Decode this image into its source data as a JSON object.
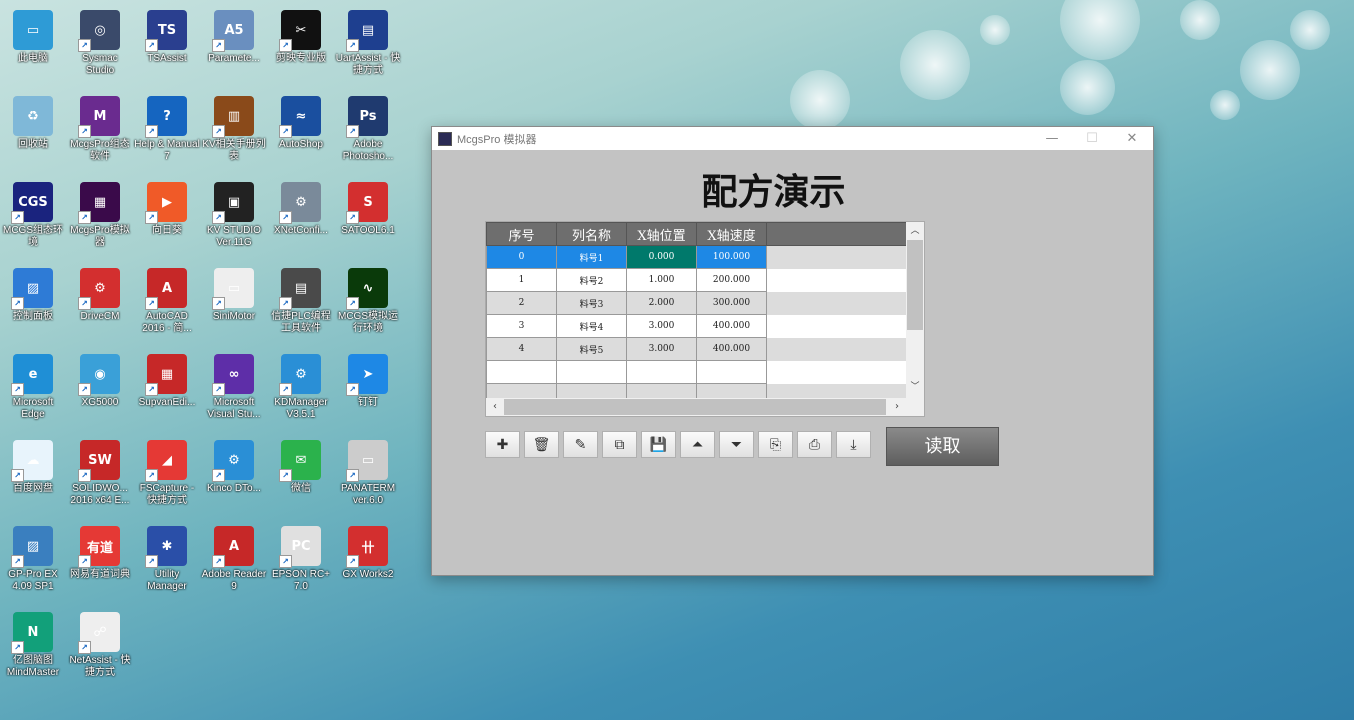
{
  "desktop": {
    "icons": [
      {
        "label": "此电脑",
        "color": "#2e9bd6",
        "glyph": "▭"
      },
      {
        "label": "Sysmac Studio",
        "color": "#3a4a6a",
        "glyph": "◎"
      },
      {
        "label": "TSAssist",
        "color": "#2a3f8f",
        "glyph": "TS"
      },
      {
        "label": "Paramete...",
        "color": "#6a8fbf",
        "glyph": "A5"
      },
      {
        "label": "剪映专业版",
        "color": "#111111",
        "glyph": "✂"
      },
      {
        "label": "UartAssist - 快捷方式",
        "color": "#1e3f8f",
        "glyph": "▤"
      },
      {
        "label": "回收站",
        "color": "#7fb8d8",
        "glyph": "♻"
      },
      {
        "label": "McgsPro组态软件",
        "color": "#6a2b8f",
        "glyph": "M"
      },
      {
        "label": "Help & Manual 7",
        "color": "#1565c0",
        "glyph": "?"
      },
      {
        "label": "KV相关手册列表",
        "color": "#8a4a1a",
        "glyph": "▥"
      },
      {
        "label": "AutoShop",
        "color": "#1a4f9f",
        "glyph": "≈"
      },
      {
        "label": "Adobe Photosho...",
        "color": "#1f3a6f",
        "glyph": "Ps"
      },
      {
        "label": "MCGS组态环境",
        "color": "#1a237e",
        "glyph": "CGS"
      },
      {
        "label": "McgsPro模拟器",
        "color": "#3a0a4a",
        "glyph": "▦"
      },
      {
        "label": "向日葵",
        "color": "#f05a28",
        "glyph": "▶"
      },
      {
        "label": "KV STUDIO Ver.11G",
        "color": "#222222",
        "glyph": "▣"
      },
      {
        "label": "XNetConfi...",
        "color": "#7a8a9a",
        "glyph": "⚙"
      },
      {
        "label": "SATOOL6.1",
        "color": "#d32f2f",
        "glyph": "S"
      },
      {
        "label": "控制面板",
        "color": "#2e7bd6",
        "glyph": "▨"
      },
      {
        "label": "DriveCM",
        "color": "#d32f2f",
        "glyph": "⚙"
      },
      {
        "label": "AutoCAD 2016 - 简...",
        "color": "#c62828",
        "glyph": "A"
      },
      {
        "label": "SiniMotor",
        "color": "#eeeeee",
        "glyph": "▭"
      },
      {
        "label": "信捷PLC编程工具软件",
        "color": "#4a4a4a",
        "glyph": "▤"
      },
      {
        "label": "MCGS模拟运行环境",
        "color": "#0a3a0a",
        "glyph": "∿"
      },
      {
        "label": "Microsoft Edge",
        "color": "#1f8fd6",
        "glyph": "e"
      },
      {
        "label": "XG5000",
        "color": "#3aa0d8",
        "glyph": "◉"
      },
      {
        "label": "SupvanEdi...",
        "color": "#c62828",
        "glyph": "▦"
      },
      {
        "label": "Microsoft Visual Stu...",
        "color": "#5e2ea8",
        "glyph": "∞"
      },
      {
        "label": "KDManager V3.5.1",
        "color": "#2a8fd6",
        "glyph": "⚙"
      },
      {
        "label": "钉钉",
        "color": "#1e88e5",
        "glyph": "➤"
      },
      {
        "label": "百度网盘",
        "color": "#e8f4fc",
        "glyph": "☁"
      },
      {
        "label": "SOLIDWO... 2016 x64 E...",
        "color": "#c62828",
        "glyph": "SW"
      },
      {
        "label": "FSCapture - 快捷方式",
        "color": "#e53935",
        "glyph": "◢"
      },
      {
        "label": "Kinco DTo...",
        "color": "#2a8fd6",
        "glyph": "⚙"
      },
      {
        "label": "微信",
        "color": "#2bb24c",
        "glyph": "✉"
      },
      {
        "label": "PANATERM ver.6.0",
        "color": "#cccccc",
        "glyph": "▭"
      },
      {
        "label": "GP-Pro EX 4.09 SP1",
        "color": "#3a7fbf",
        "glyph": "▨"
      },
      {
        "label": "网易有道词典",
        "color": "#e53935",
        "glyph": "有道"
      },
      {
        "label": "Utility Manager",
        "color": "#2a4fa8",
        "glyph": "✱"
      },
      {
        "label": "Adobe Reader 9",
        "color": "#c62828",
        "glyph": "A"
      },
      {
        "label": "EPSON RC+ 7.0",
        "color": "#e0e0e0",
        "glyph": "PC"
      },
      {
        "label": "GX Works2",
        "color": "#d32f2f",
        "glyph": "卄"
      },
      {
        "label": "亿图脑图MindMaster",
        "color": "#12a07a",
        "glyph": "N"
      },
      {
        "label": "NetAssist - 快捷方式",
        "color": "#eeeeee",
        "glyph": "☍"
      }
    ]
  },
  "window": {
    "title": "McgsPro 模拟器",
    "min_glyph": "—",
    "max_glyph": "☐",
    "close_glyph": "✕",
    "heading": "配方演示",
    "table": {
      "columns": [
        "序号",
        "列名称",
        "X轴位置",
        "X轴速度"
      ],
      "rows": [
        [
          "0",
          "料号1",
          "0.000",
          "100.000"
        ],
        [
          "1",
          "料号2",
          "1.000",
          "200.000"
        ],
        [
          "2",
          "料号3",
          "2.000",
          "300.000"
        ],
        [
          "3",
          "料号4",
          "3.000",
          "400.000"
        ],
        [
          "4",
          "料号5",
          "3.000",
          "400.000"
        ]
      ],
      "selected_row": 0
    },
    "scroll": {
      "up": "︿",
      "down": "﹀",
      "left": "‹",
      "right": "›"
    },
    "toolbar": [
      {
        "name": "add-row-icon",
        "glyph": "✚"
      },
      {
        "name": "delete-row-icon",
        "glyph": "🗑"
      },
      {
        "name": "edit-icon",
        "glyph": "✎"
      },
      {
        "name": "copy-icon",
        "glyph": "⧉"
      },
      {
        "name": "save-icon",
        "glyph": "💾"
      },
      {
        "name": "move-top-icon",
        "glyph": "⏶"
      },
      {
        "name": "move-bottom-icon",
        "glyph": "⏷"
      },
      {
        "name": "import-icon",
        "glyph": "⎘"
      },
      {
        "name": "export-icon",
        "glyph": "⎙"
      },
      {
        "name": "download-icon",
        "glyph": "⤓"
      }
    ],
    "read_button": "读取"
  }
}
